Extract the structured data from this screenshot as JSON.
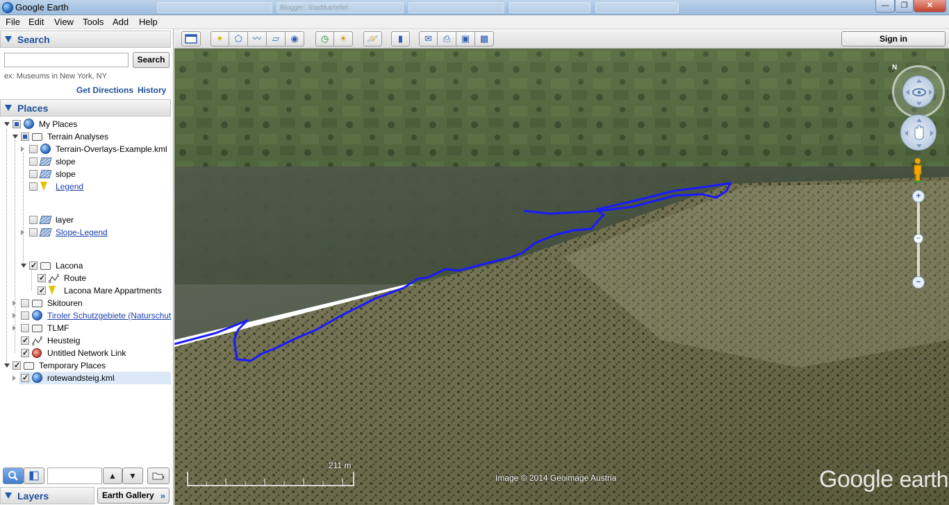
{
  "window": {
    "title": "Google Earth",
    "ghost_tabs": [
      "",
      "",
      "Blogger: Stadtkartellel",
      "",
      "",
      ""
    ],
    "controls": {
      "minimize": "—",
      "maximize": "❐",
      "close": "✕"
    }
  },
  "menu": {
    "items": [
      {
        "label": "File",
        "accel": "F"
      },
      {
        "label": "Edit",
        "accel": "E"
      },
      {
        "label": "View",
        "accel": "V"
      },
      {
        "label": "Tools",
        "accel": "T"
      },
      {
        "label": "Add",
        "accel": "A"
      },
      {
        "label": "Help",
        "accel": "H"
      }
    ]
  },
  "search": {
    "header": "Search",
    "input_value": "",
    "button": "Search",
    "hint": "ex: Museums in New York, NY",
    "get_directions": "Get Directions",
    "history": "History"
  },
  "places": {
    "header": "Places",
    "items": [
      {
        "label": "My Places",
        "level": 0,
        "check": "partial",
        "icon": "globe-icon",
        "expand": "open"
      },
      {
        "label": "Terrain Analyses",
        "level": 1,
        "check": "partial",
        "icon": "folder-icon",
        "expand": "open"
      },
      {
        "label": "Terrain-Overlays-Example.kml",
        "level": 2,
        "check": "none",
        "icon": "globe-icon",
        "expand": "closed"
      },
      {
        "label": "slope",
        "level": 2,
        "check": "none",
        "icon": "layer-icon",
        "expand": "none"
      },
      {
        "label": "slope",
        "level": 2,
        "check": "none",
        "icon": "layer-icon",
        "expand": "none"
      },
      {
        "label": "Legend",
        "level": 2,
        "check": "none",
        "icon": "pin-icon",
        "expand": "none",
        "link": true
      },
      {
        "label": "layer",
        "level": 2,
        "check": "none",
        "icon": "layer-icon",
        "expand": "none"
      },
      {
        "label": "Slope-Legend",
        "level": 2,
        "check": "none",
        "icon": "layer-icon",
        "expand": "closed",
        "link": true
      },
      {
        "label": "Lacona",
        "level": 2,
        "check": "checked",
        "icon": "folder-icon",
        "expand": "open"
      },
      {
        "label": "Route",
        "level": 3,
        "check": "checked",
        "icon": "path-icon",
        "expand": "none"
      },
      {
        "label": "Lacona Mare Appartments",
        "level": 3,
        "check": "checked",
        "icon": "pin-icon",
        "expand": "none"
      },
      {
        "label": "Skitouren",
        "level": 1,
        "check": "none",
        "icon": "folder-icon",
        "expand": "closed"
      },
      {
        "label": "Tiroler Schutzgebiete (Naturschut",
        "level": 1,
        "check": "none",
        "icon": "globe-icon",
        "expand": "closed",
        "link": true
      },
      {
        "label": "TLMF",
        "level": 1,
        "check": "none",
        "icon": "folder-icon",
        "expand": "closed"
      },
      {
        "label": "Heusteig",
        "level": 1,
        "check": "checked",
        "icon": "path-icon",
        "expand": "none"
      },
      {
        "label": "Untitled Network Link",
        "level": 1,
        "check": "checked",
        "icon": "network-link-icon",
        "expand": "none"
      },
      {
        "label": "Temporary Places",
        "level": 0,
        "check": "checked",
        "icon": "folder-icon",
        "expand": "open"
      },
      {
        "label": "rotewandsteig.kml",
        "level": 1,
        "check": "checked",
        "icon": "globe-icon",
        "expand": "closed",
        "selected": true
      }
    ]
  },
  "layers": {
    "header": "Layers",
    "earth_gallery": "Earth Gallery",
    "gallery_chevron": "»"
  },
  "toolbar": {
    "sign_in": "Sign in"
  },
  "map": {
    "scale_label": "211 m",
    "credit": "Image © 2014 Geoimage Austria",
    "watermark_google": "Google",
    "watermark_earth": "earth",
    "route_color": "#1a1aff",
    "north_label": "N"
  },
  "colors": {
    "accent": "#1e4f9a",
    "link": "#1a3ea8",
    "selection": "#dbe8f8"
  }
}
